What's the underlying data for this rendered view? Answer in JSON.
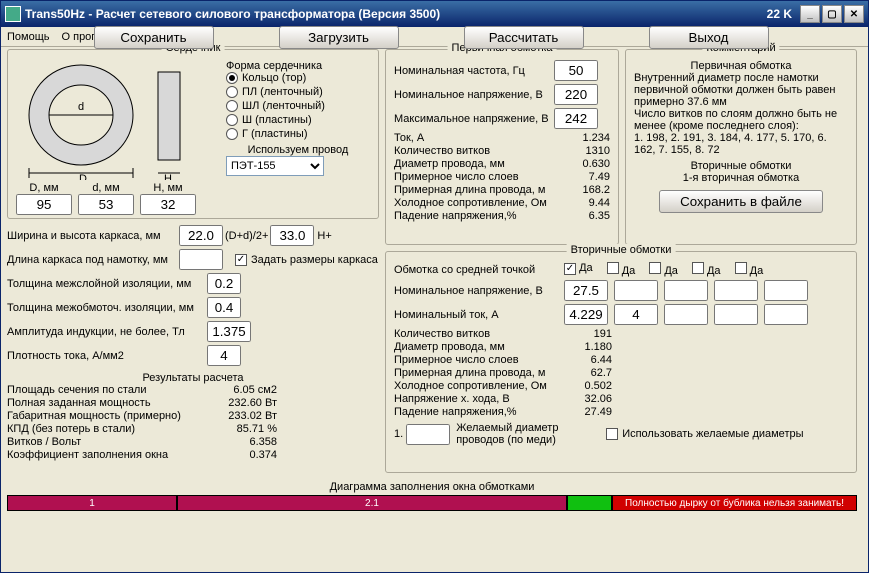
{
  "window": {
    "title": "Trans50Hz - Расчет сетевого силового трансформатора (Версия 3500)",
    "stat": "22 K"
  },
  "menu": {
    "help": "Помощь",
    "about": "О программе..."
  },
  "core": {
    "title": "Сердечник",
    "shapeLabel": "Форма сердечника",
    "shapes": [
      {
        "label": "Кольцо (тор)",
        "checked": true
      },
      {
        "label": "ПЛ (ленточный)",
        "checked": false
      },
      {
        "label": "ШЛ (ленточный)",
        "checked": false
      },
      {
        "label": "Ш (пластины)",
        "checked": false
      },
      {
        "label": "Г (пластины)",
        "checked": false
      }
    ],
    "wireUseLabel": "Используем провод",
    "wireSelect": "ПЭТ-155",
    "dims": {
      "Dlabel": "D, мм",
      "dlabel": "d, мм",
      "Hlabel": "H, мм",
      "D": "95",
      "d": "53",
      "H": "32"
    },
    "frameWH": "Ширина и высота каркаса, мм",
    "frameW": "22.0",
    "frameMid": "(D+d)/2+",
    "frameH": "33.0",
    "frameSuffix": "H+",
    "frameLen": "Длина каркаса под намотку, мм",
    "setDims": "Задать размеры каркаса",
    "setDimsChecked": true,
    "interlayer": "Толщина межслойной изоляции, мм",
    "interlayerV": "0.2",
    "interwind": "Толщина межобмоточ. изоляции, мм",
    "interwindV": "0.4",
    "induction": "Амплитуда индукции, не более, Тл",
    "inductionV": "1.375",
    "density": "Плотность тока, А/мм2",
    "densityV": "4"
  },
  "results": {
    "title": "Результаты расчета",
    "rows": [
      {
        "l": "Площадь сечения по стали",
        "v": "6.05 см2"
      },
      {
        "l": "Полная заданная мощность",
        "v": "232.60 Вт"
      },
      {
        "l": "Габаритная мощность (примерно)",
        "v": "233.02 Вт"
      },
      {
        "l": "КПД (без потерь в стали)",
        "v": "85.71 %"
      },
      {
        "l": "Витков / Вольт",
        "v": "6.358"
      },
      {
        "l": "Коэффициент заполнения окна",
        "v": "0.374"
      }
    ]
  },
  "primary": {
    "title": "Первичная обмотка",
    "freq": "Номинальная частота, Гц",
    "freqV": "50",
    "nomV": "Номинальное напряжение, В",
    "nomVV": "220",
    "maxV": "Максимальное напряжение, В",
    "maxVV": "242",
    "rows": [
      {
        "l": "Ток, А",
        "v": "1.234"
      },
      {
        "l": "Количество витков",
        "v": "1310"
      },
      {
        "l": "Диаметр провода, мм",
        "v": "0.630"
      },
      {
        "l": "Примерное число слоев",
        "v": "7.49"
      },
      {
        "l": "Примерная длина провода, м",
        "v": "168.2"
      },
      {
        "l": "Холодное сопротивление, Ом",
        "v": "9.44"
      },
      {
        "l": "Падение напряжения,%",
        "v": "6.35"
      }
    ]
  },
  "comment": {
    "title": "Комментарий",
    "p1": "Первичная обмотка",
    "p2": "Внутренний диаметр после намотки первичной обмотки должен быть равен примерно 37.6 мм",
    "p3": "Число витков по слоям должно быть не менее (кроме последнего слоя):",
    "p4": "1. 198,  2. 191,  3. 184,  4. 177,  5. 170,  6. 162,  7. 155,  8. 72",
    "secTitle": "Вторичные обмотки",
    "sec1": "1-я вторичная обмотка",
    "saveBtn": "Сохранить в файле"
  },
  "secondary": {
    "title": "Вторичные обмотки",
    "centerTap": "Обмотка со средней точкой",
    "yes": "Да",
    "checks": [
      true,
      false,
      false,
      false,
      false
    ],
    "nomV": "Номинальное напряжение, В",
    "nomVV": "27.5",
    "nomI": "Номинальный ток, А",
    "nomIV": "4.229",
    "nomIV2": "4",
    "rows": [
      {
        "l": "Количество витков",
        "v": "191"
      },
      {
        "l": "Диаметр провода, мм",
        "v": "1.180"
      },
      {
        "l": "Примерное число слоев",
        "v": "6.44"
      },
      {
        "l": "Примерная длина провода, м",
        "v": "62.7"
      },
      {
        "l": "Холодное сопротивление, Ом",
        "v": "0.502"
      },
      {
        "l": "Напряжение х. хода, В",
        "v": "32.06"
      },
      {
        "l": "Падение напряжения,%",
        "v": "27.49"
      }
    ],
    "desiredNum": "1.",
    "desiredLbl": "Желаемый диаметр проводов (по меди)",
    "useDesired": "Использовать желаемые диаметры"
  },
  "diagram": {
    "title": "Диаграмма заполнения окна обмотками",
    "seg1": "1",
    "seg21": "2.1",
    "warn": "Полностью дырку от бублика нельзя занимать!"
  },
  "btns": {
    "save": "Сохранить",
    "load": "Загрузить",
    "calc": "Рассчитать",
    "exit": "Выход"
  }
}
